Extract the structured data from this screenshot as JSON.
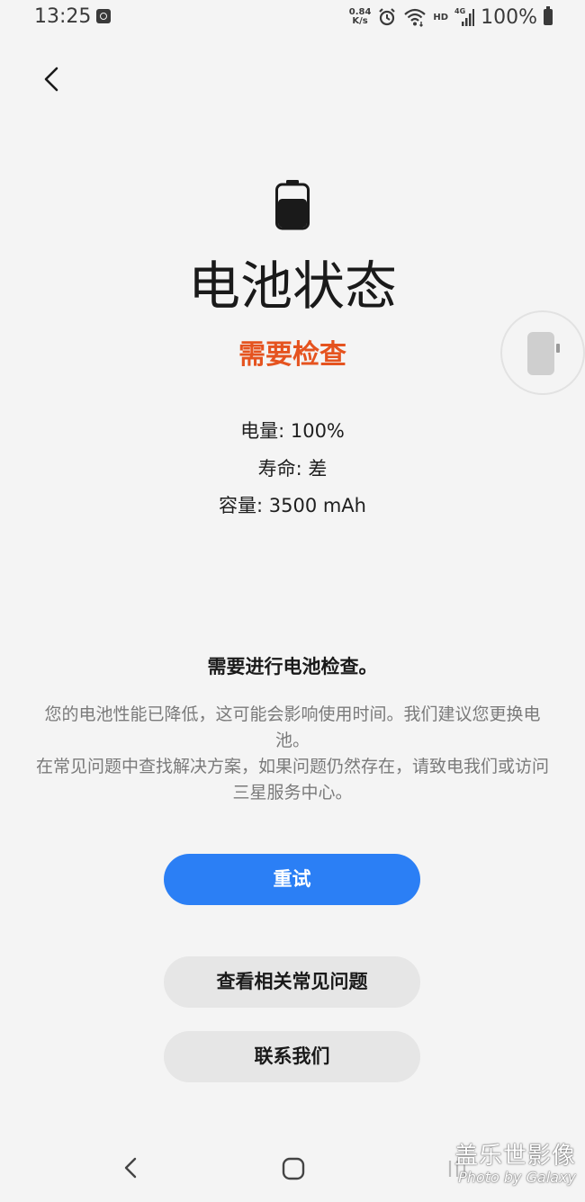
{
  "status_bar": {
    "time": "13:25",
    "net_speed_value": "0.84",
    "net_speed_unit": "K/s",
    "hd_label": "HD",
    "network_type": "4G",
    "battery_percent": "100%",
    "icons": [
      "app-notification-icon",
      "alarm-icon",
      "wifi-icon",
      "signal-icon",
      "battery-icon"
    ]
  },
  "header": {
    "back_icon": "chevron-left-icon"
  },
  "hero": {
    "icon": "battery-icon",
    "title": "电池状态",
    "status": "需要检查",
    "status_color": "#e5531f"
  },
  "info": {
    "charge": "电量: 100%",
    "life": "寿命: 差",
    "capacity": "容量: 3500 mAh"
  },
  "notice": {
    "heading": "需要进行电池检查。",
    "line1": "您的电池性能已降低，这可能会影响使用时间。我们建议您更换电池。",
    "line2": "在常见问题中查找解决方案，如果问题仍然存在，请致电我们或访问三星服务中心。"
  },
  "buttons": {
    "retry": "重试",
    "faq": "查看相关常见问题",
    "contact": "联系我们",
    "primary_color": "#2b7ff5"
  },
  "nav": {
    "icons": [
      "back-icon",
      "home-icon",
      "recent-apps-icon"
    ]
  },
  "watermark": {
    "main": "盖乐世影像",
    "sub": "Photo by Galaxy"
  }
}
